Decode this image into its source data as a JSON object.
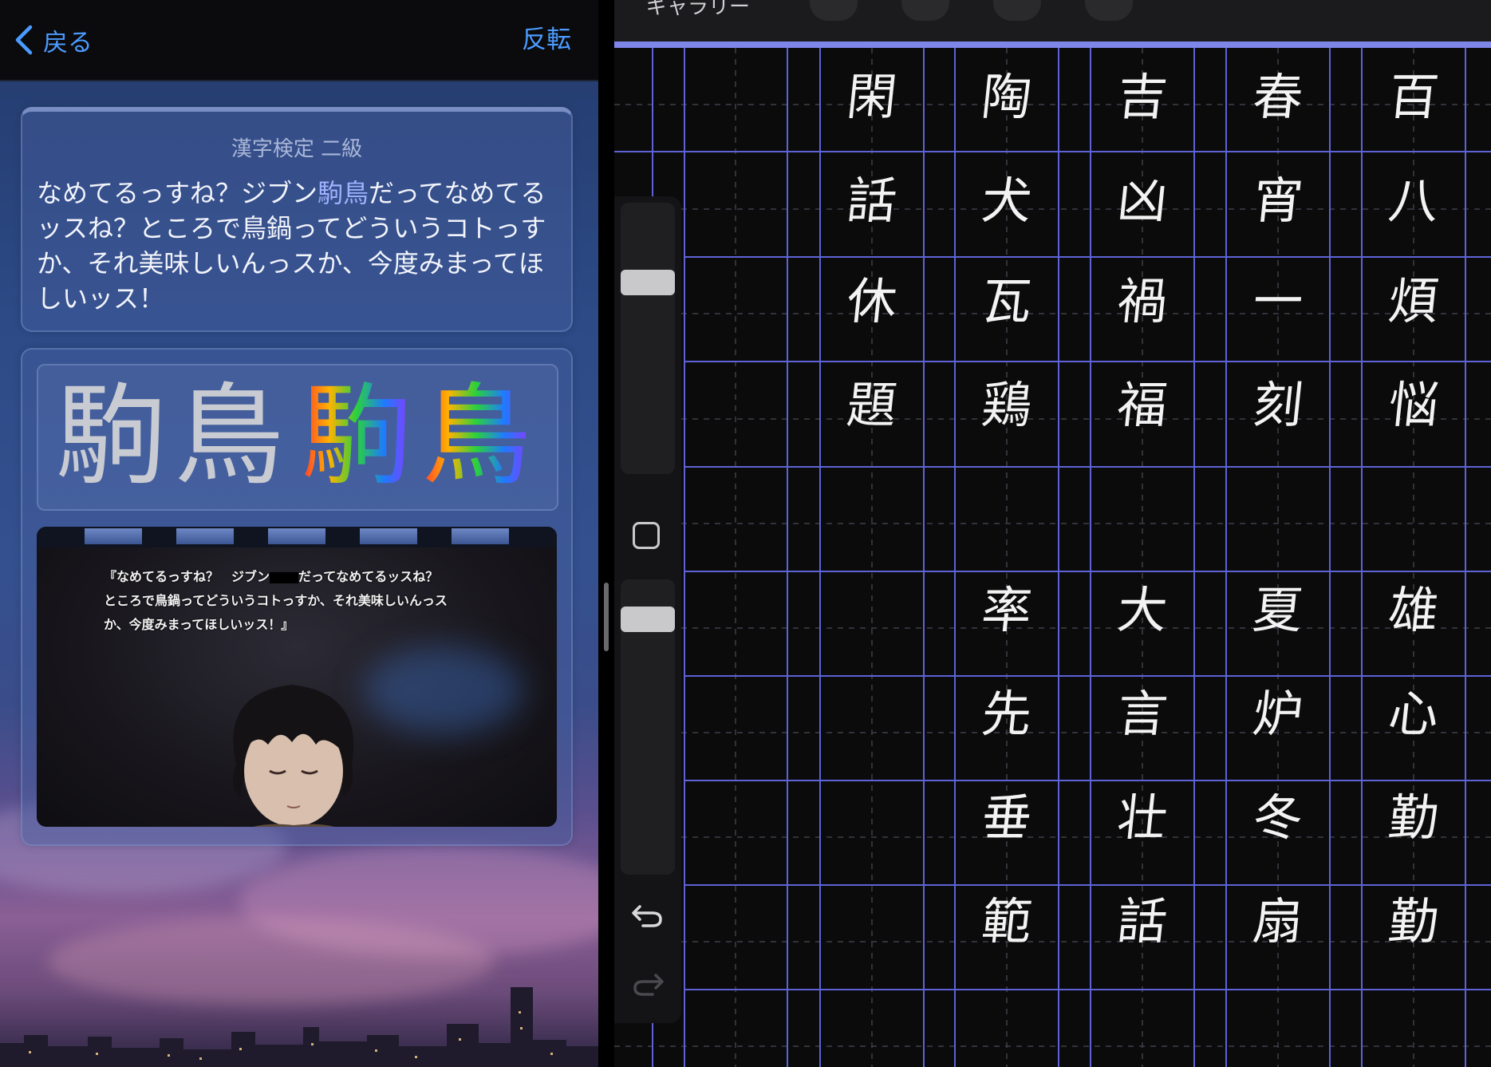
{
  "navbar": {
    "back_label": "戻る",
    "flip_label": "反転"
  },
  "question": {
    "category": "漢字検定 二級",
    "text_before": "なめてるっすね？ジブン",
    "highlight": "駒鳥",
    "text_after": "だってなめてるッスね？ところで鳥鍋ってどういうコトっすか、それ美味しいんっスか、今度みまってほしいッス！"
  },
  "stroke_display": {
    "answer_chars": [
      "駒",
      "鳥"
    ]
  },
  "game_screenshot": {
    "line1_before": "『なめてるっすね？　ジブン",
    "line1_after": "だってなめてるッスね？",
    "line2": "ところで鳥鍋ってどういうコトっすか、それ美味しいんっス",
    "line3": "か、今度みまってほしいッス！』"
  },
  "toolbar": {
    "gallery_label": "ギャラリー"
  },
  "practice_grid": {
    "rows": [
      [
        "閑",
        "陶",
        "吉",
        "春",
        "百"
      ],
      [
        "話",
        "犬",
        "凶",
        "宵",
        "八"
      ],
      [
        "休",
        "瓦",
        "禍",
        "一",
        "煩"
      ],
      [
        "題",
        "鶏",
        "福",
        "刻",
        "悩"
      ],
      [
        "",
        "",
        "",
        "",
        ""
      ],
      [
        "",
        "率",
        "大",
        "夏",
        "雄"
      ],
      [
        "",
        "先",
        "言",
        "炉",
        "心"
      ],
      [
        "",
        "垂",
        "壮",
        "冬",
        "勤"
      ],
      [
        "",
        "範",
        "話",
        "扇",
        "勤"
      ]
    ]
  },
  "colors": {
    "accent_blue": "#4b9bff",
    "grid_line": "#5d63d6",
    "accent_line": "#7f86ea"
  },
  "icons": [
    "chevron-left-icon",
    "undo-icon",
    "redo-icon",
    "modify-square-icon"
  ]
}
